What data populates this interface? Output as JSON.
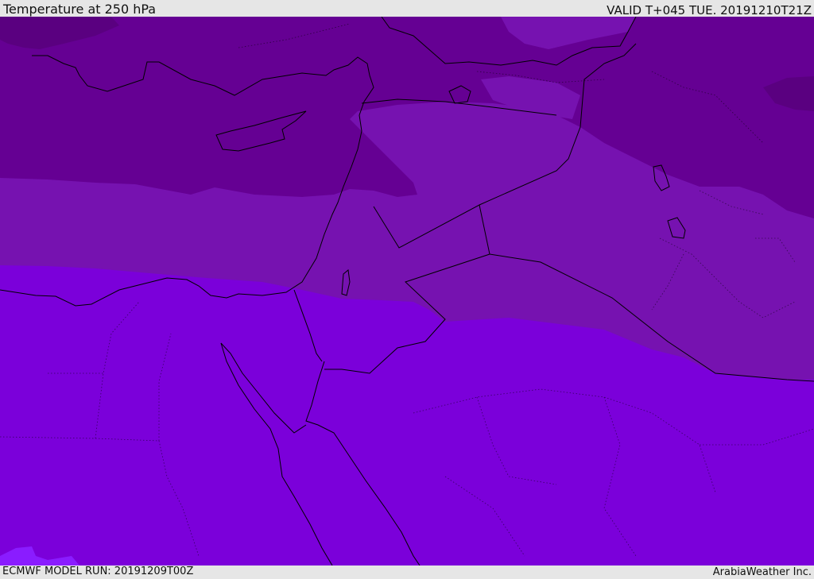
{
  "header": {
    "title": "Temperature at 250 hPa",
    "valid": "VALID T+045 TUE. 20191210T21Z"
  },
  "footer": {
    "model_run": "ECMWF MODEL RUN: 20191209T00Z",
    "brand": "ArabiaWeather Inc."
  },
  "colors": {
    "coldest": "#5a0080",
    "band_1": "#650093",
    "band_2": "#7612b0",
    "band_3": "#7b00da",
    "band_4": "#8a1cff"
  }
}
